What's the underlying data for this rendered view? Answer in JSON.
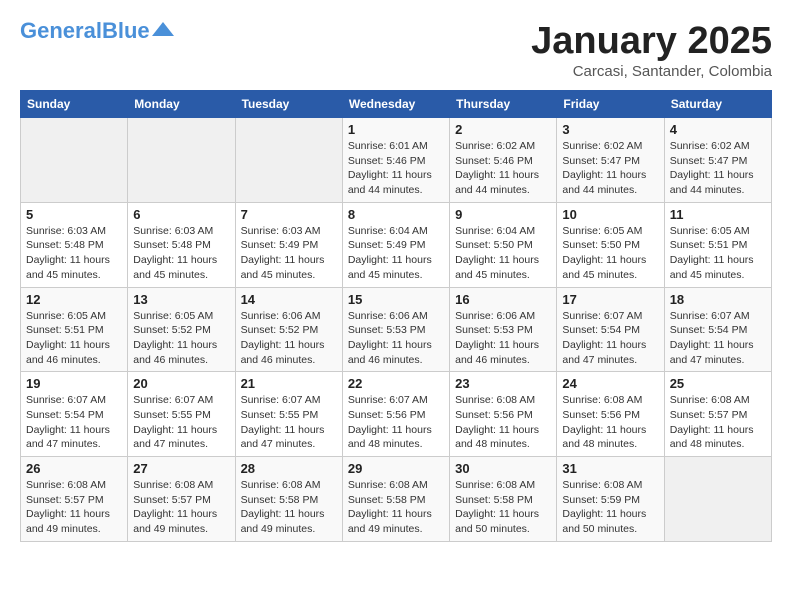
{
  "header": {
    "logo_general": "General",
    "logo_blue": "Blue",
    "month": "January 2025",
    "location": "Carcasi, Santander, Colombia"
  },
  "days_of_week": [
    "Sunday",
    "Monday",
    "Tuesday",
    "Wednesday",
    "Thursday",
    "Friday",
    "Saturday"
  ],
  "weeks": [
    [
      {
        "day": "",
        "info": ""
      },
      {
        "day": "",
        "info": ""
      },
      {
        "day": "",
        "info": ""
      },
      {
        "day": "1",
        "info": "Sunrise: 6:01 AM\nSunset: 5:46 PM\nDaylight: 11 hours and 44 minutes."
      },
      {
        "day": "2",
        "info": "Sunrise: 6:02 AM\nSunset: 5:46 PM\nDaylight: 11 hours and 44 minutes."
      },
      {
        "day": "3",
        "info": "Sunrise: 6:02 AM\nSunset: 5:47 PM\nDaylight: 11 hours and 44 minutes."
      },
      {
        "day": "4",
        "info": "Sunrise: 6:02 AM\nSunset: 5:47 PM\nDaylight: 11 hours and 44 minutes."
      }
    ],
    [
      {
        "day": "5",
        "info": "Sunrise: 6:03 AM\nSunset: 5:48 PM\nDaylight: 11 hours and 45 minutes."
      },
      {
        "day": "6",
        "info": "Sunrise: 6:03 AM\nSunset: 5:48 PM\nDaylight: 11 hours and 45 minutes."
      },
      {
        "day": "7",
        "info": "Sunrise: 6:03 AM\nSunset: 5:49 PM\nDaylight: 11 hours and 45 minutes."
      },
      {
        "day": "8",
        "info": "Sunrise: 6:04 AM\nSunset: 5:49 PM\nDaylight: 11 hours and 45 minutes."
      },
      {
        "day": "9",
        "info": "Sunrise: 6:04 AM\nSunset: 5:50 PM\nDaylight: 11 hours and 45 minutes."
      },
      {
        "day": "10",
        "info": "Sunrise: 6:05 AM\nSunset: 5:50 PM\nDaylight: 11 hours and 45 minutes."
      },
      {
        "day": "11",
        "info": "Sunrise: 6:05 AM\nSunset: 5:51 PM\nDaylight: 11 hours and 45 minutes."
      }
    ],
    [
      {
        "day": "12",
        "info": "Sunrise: 6:05 AM\nSunset: 5:51 PM\nDaylight: 11 hours and 46 minutes."
      },
      {
        "day": "13",
        "info": "Sunrise: 6:05 AM\nSunset: 5:52 PM\nDaylight: 11 hours and 46 minutes."
      },
      {
        "day": "14",
        "info": "Sunrise: 6:06 AM\nSunset: 5:52 PM\nDaylight: 11 hours and 46 minutes."
      },
      {
        "day": "15",
        "info": "Sunrise: 6:06 AM\nSunset: 5:53 PM\nDaylight: 11 hours and 46 minutes."
      },
      {
        "day": "16",
        "info": "Sunrise: 6:06 AM\nSunset: 5:53 PM\nDaylight: 11 hours and 46 minutes."
      },
      {
        "day": "17",
        "info": "Sunrise: 6:07 AM\nSunset: 5:54 PM\nDaylight: 11 hours and 47 minutes."
      },
      {
        "day": "18",
        "info": "Sunrise: 6:07 AM\nSunset: 5:54 PM\nDaylight: 11 hours and 47 minutes."
      }
    ],
    [
      {
        "day": "19",
        "info": "Sunrise: 6:07 AM\nSunset: 5:54 PM\nDaylight: 11 hours and 47 minutes."
      },
      {
        "day": "20",
        "info": "Sunrise: 6:07 AM\nSunset: 5:55 PM\nDaylight: 11 hours and 47 minutes."
      },
      {
        "day": "21",
        "info": "Sunrise: 6:07 AM\nSunset: 5:55 PM\nDaylight: 11 hours and 47 minutes."
      },
      {
        "day": "22",
        "info": "Sunrise: 6:07 AM\nSunset: 5:56 PM\nDaylight: 11 hours and 48 minutes."
      },
      {
        "day": "23",
        "info": "Sunrise: 6:08 AM\nSunset: 5:56 PM\nDaylight: 11 hours and 48 minutes."
      },
      {
        "day": "24",
        "info": "Sunrise: 6:08 AM\nSunset: 5:56 PM\nDaylight: 11 hours and 48 minutes."
      },
      {
        "day": "25",
        "info": "Sunrise: 6:08 AM\nSunset: 5:57 PM\nDaylight: 11 hours and 48 minutes."
      }
    ],
    [
      {
        "day": "26",
        "info": "Sunrise: 6:08 AM\nSunset: 5:57 PM\nDaylight: 11 hours and 49 minutes."
      },
      {
        "day": "27",
        "info": "Sunrise: 6:08 AM\nSunset: 5:57 PM\nDaylight: 11 hours and 49 minutes."
      },
      {
        "day": "28",
        "info": "Sunrise: 6:08 AM\nSunset: 5:58 PM\nDaylight: 11 hours and 49 minutes."
      },
      {
        "day": "29",
        "info": "Sunrise: 6:08 AM\nSunset: 5:58 PM\nDaylight: 11 hours and 49 minutes."
      },
      {
        "day": "30",
        "info": "Sunrise: 6:08 AM\nSunset: 5:58 PM\nDaylight: 11 hours and 50 minutes."
      },
      {
        "day": "31",
        "info": "Sunrise: 6:08 AM\nSunset: 5:59 PM\nDaylight: 11 hours and 50 minutes."
      },
      {
        "day": "",
        "info": ""
      }
    ]
  ]
}
